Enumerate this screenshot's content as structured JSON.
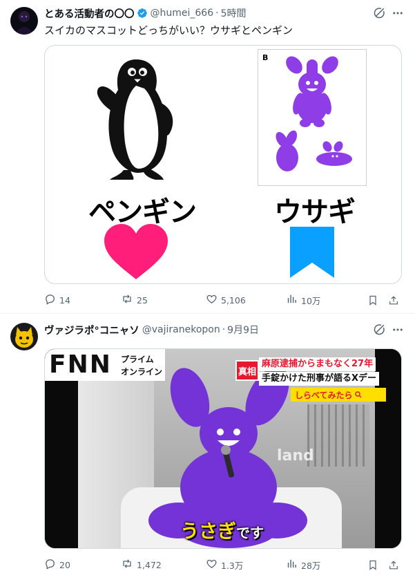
{
  "tweet1": {
    "name": "とある活動者の〇〇",
    "handle": "@humei_666",
    "dot": "·",
    "time": "5時間",
    "text": "スイカのマスコットどっちがいい？ウサギとペンギン",
    "image": {
      "left_label": "ペンギン",
      "right_label": "ウサギ",
      "panel_letter": "B"
    },
    "actions": {
      "replies": "14",
      "retweets": "25",
      "likes": "5,106",
      "views": "10万"
    }
  },
  "tweet2": {
    "name": "ヴァジラポ°コニャソ",
    "handle": "@vajiranekopon",
    "dot": "·",
    "time": "9月9日",
    "image": {
      "logo": "FNN",
      "logo_sub_1": "プライム",
      "logo_sub_2": "オンライン",
      "tag": "真相",
      "headline_1": "麻原逮捕からまもなく27年",
      "headline_2": "手錠かけた刑事が語るXデー",
      "search_label": "しらべてみたら",
      "subtitle_yellow": "うさぎ",
      "subtitle_white": "です",
      "backdrop_text": "land"
    },
    "actions": {
      "replies": "20",
      "retweets": "1,472",
      "likes": "1.3万",
      "views": "28万"
    }
  },
  "colors": {
    "accent": "#1d9bf0",
    "text_secondary": "#536471",
    "heart_pink": "#ff1f7a",
    "ribbon_blue": "#0aa0ff",
    "mascot_purple": "#7b3fd9",
    "headline_red": "#e8182e"
  },
  "icons": {
    "verified": "verified-badge-icon",
    "grok": "grok-icon",
    "more": "more-icon",
    "reply": "reply-icon",
    "retweet": "retweet-icon",
    "like": "like-icon",
    "views": "views-icon",
    "bookmark": "bookmark-icon",
    "share": "share-icon"
  }
}
